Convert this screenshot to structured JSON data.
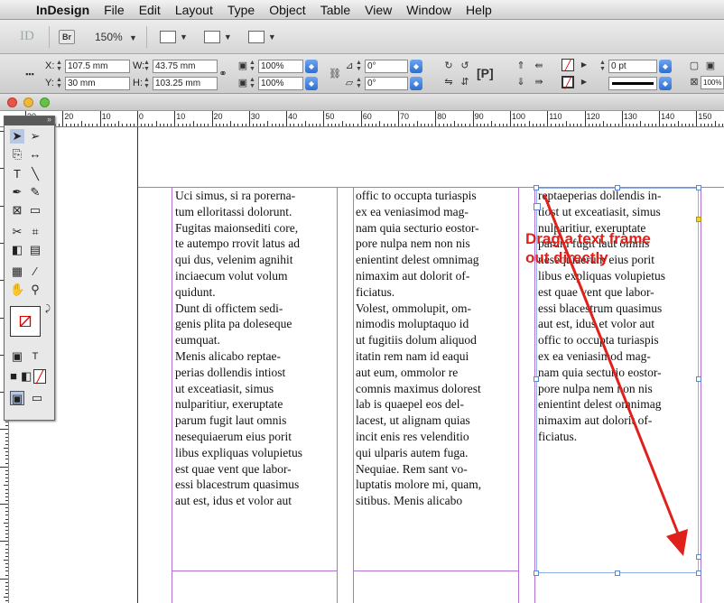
{
  "menubar": {
    "apple": "",
    "app": "InDesign",
    "items": [
      "File",
      "Edit",
      "Layout",
      "Type",
      "Object",
      "Table",
      "View",
      "Window",
      "Help"
    ]
  },
  "appbar": {
    "logo": "ID",
    "bridge": "Br",
    "zoom": "150%",
    "zoom_arrow": "▼"
  },
  "control": {
    "x": "107.5 mm",
    "y": "30 mm",
    "w": "43.75 mm",
    "h": "103.25 mm",
    "scale_x": "100%",
    "scale_y": "100%",
    "rotate": "0°",
    "shear": "0°",
    "stroke": "0 pt",
    "opacity": "100%"
  },
  "ruler": {
    "labels": [
      "30",
      "20",
      "10",
      "0",
      "10",
      "20",
      "30",
      "40",
      "50",
      "60",
      "70",
      "80",
      "90",
      "100",
      "110",
      "120",
      "130",
      "140",
      "150"
    ]
  },
  "columns": {
    "col1": [
      "Uci simus, si ra porerna-",
      "tum elloritassi dolorunt.",
      "Fugitas maionsediti core,",
      "te autempo rrovit latus ad",
      "qui dus, velenim agnihit",
      "inciaecum volut volum",
      "quidunt.",
      "Dunt di offictem sedi-",
      "genis plita pa doleseque",
      "eumquat.",
      "Menis alicabo reptae-",
      "perias dollendis intiost",
      "ut exceatiasit, simus",
      "nulparitiur, exeruptate",
      "parum fugit laut omnis",
      "nesequiaerum eius porit",
      "libus expliquas volupietus",
      "est quae vent que labor-",
      "essi blacestrum quasimus",
      "aut est, idus et volor aut"
    ],
    "col2": [
      "offic to occupta turiaspis",
      "ex ea veniasimod mag-",
      "nam quia secturio eostor-",
      "pore nulpa nem non nis",
      "enientint delest omnimag",
      "nimaxim aut dolorit of-",
      "ficiatus.",
      "Volest, ommolupit, om-",
      "nimodis moluptaquo id",
      "ut fugitiis dolum aliquod",
      "itatin rem nam id eaqui",
      "aut eum, ommolor re",
      "comnis maximus dolorest",
      "lab is quaepel eos del-",
      "lacest, ut alignam quias",
      "incit enis res velenditio",
      "qui ulparis autem fuga.",
      "Nequiae. Rem sant vo-",
      "luptatis molore mi, quam,",
      "sitibus. Menis alicabo"
    ],
    "col3": [
      "reptaeperias dollendis in-",
      "tiost ut exceatiasit, simus",
      "nulparitiur, exeruptate",
      "parum fugit laut omnis",
      "nesequiaerum eius porit",
      "libus expliquas volupietus",
      "est quae vent que labor-",
      "essi blacestrum quasimus",
      "aut est, idus et volor aut",
      "offic to occupta turiaspis",
      "ex ea veniasimod mag-",
      "nam quia secturio eostor-",
      "pore nulpa nem non nis",
      "enientint delest omnimag",
      "nimaxim aut dolorit of-",
      "ficiatus."
    ]
  },
  "annotation": {
    "text": "Drag a text frame\nout directly",
    "color": "#e0201a"
  },
  "colors": {
    "guide": "#b36fd6",
    "frame": "#8fb0e6",
    "accent": "#2d6fd0"
  }
}
